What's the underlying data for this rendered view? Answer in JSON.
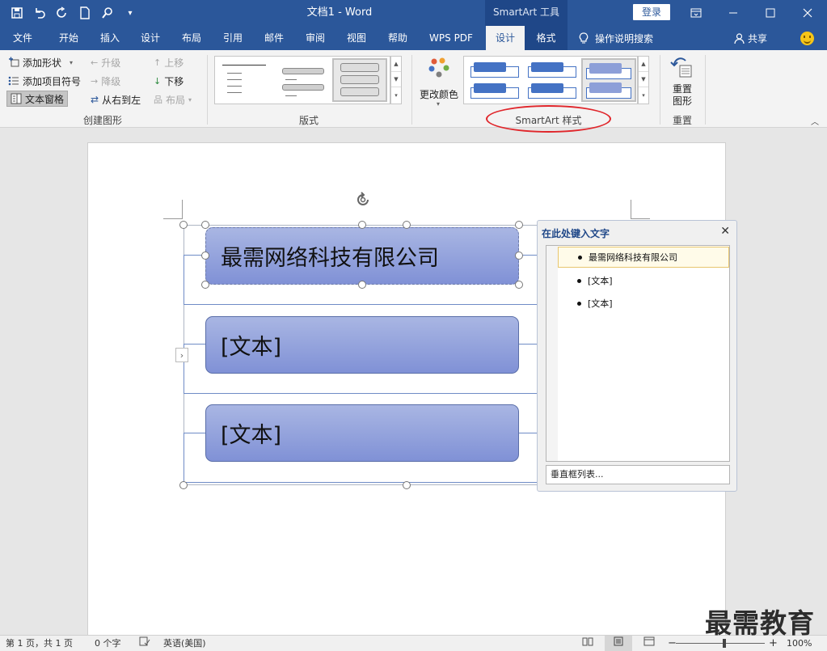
{
  "window": {
    "title": "文档1  -  Word",
    "context_tool": "SmartArt 工具",
    "login": "登录"
  },
  "tabs": [
    "文件",
    "开始",
    "插入",
    "设计",
    "布局",
    "引用",
    "邮件",
    "审阅",
    "视图",
    "帮助",
    "WPS PDF",
    "设计",
    "格式"
  ],
  "active_tab": "设计",
  "tell_me": "操作说明搜索",
  "share": "共享",
  "ribbon": {
    "create": {
      "add_shape": "添加形状",
      "add_bullet": "添加项目符号",
      "text_pane": "文本窗格",
      "promote": "升级",
      "demote": "降级",
      "right_to_left": "从右到左",
      "move_up": "上移",
      "move_down": "下移",
      "layout": "布局",
      "label": "创建图形"
    },
    "layouts_label": "版式",
    "change_colors": "更改颜色",
    "styles_label": "SmartArt 样式",
    "reset": {
      "button": "重置\n图形",
      "button_line1": "重置",
      "button_line2": "图形",
      "label": "重置"
    }
  },
  "smartart": {
    "items": [
      "最需网络科技有限公司",
      "[文本]",
      "[文本]"
    ]
  },
  "text_pane": {
    "title": "在此处键入文字",
    "items": [
      "最需网络科技有限公司",
      "[文本]",
      "[文本]"
    ],
    "footer": "垂直框列表..."
  },
  "status": {
    "page": "第 1 页，共 1 页",
    "words": "0 个字",
    "language": "英语(美国)",
    "zoom": "100%"
  },
  "watermark": "最需教育"
}
